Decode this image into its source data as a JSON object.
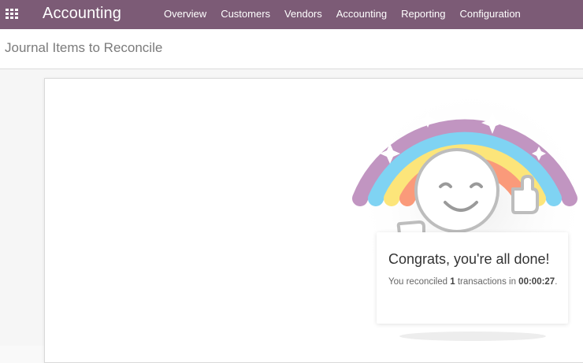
{
  "topbar": {
    "app_title": "Accounting",
    "menu": [
      "Overview",
      "Customers",
      "Vendors",
      "Accounting",
      "Reporting",
      "Configuration"
    ]
  },
  "breadcrumb": {
    "title": "Journal Items to Reconcile"
  },
  "done_card": {
    "title": "Congrats, you're all done!",
    "text_prefix": "You reconciled ",
    "count": "1",
    "text_middle": " transactions in ",
    "time": "00:00:27",
    "text_suffix": "."
  },
  "colors": {
    "topbar": "#7c5b76",
    "rainbow": [
      "#c195c1",
      "#7fd3f3",
      "#fce57a",
      "#fa9a7a"
    ]
  }
}
